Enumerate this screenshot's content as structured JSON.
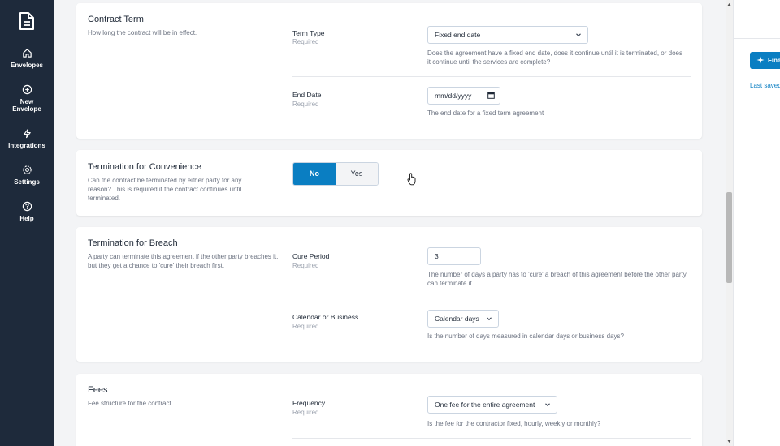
{
  "sidebar": {
    "items": [
      {
        "label": "Envelopes",
        "icon": "home-icon"
      },
      {
        "label": "New\nEnvelope",
        "icon": "plus-circle-icon"
      },
      {
        "label": "Integrations",
        "icon": "lightning-icon"
      },
      {
        "label": "Settings",
        "icon": "gear-icon"
      },
      {
        "label": "Help",
        "icon": "question-circle-icon"
      }
    ]
  },
  "contract_term": {
    "title": "Contract Term",
    "desc": "How long the contract will be in effect.",
    "term_type": {
      "label": "Term Type",
      "required": "Required",
      "value": "Fixed end date",
      "help": "Does the agreement have a fixed end date, does it continue until it is terminated, or does it continue until the services are complete?"
    },
    "end_date": {
      "label": "End Date",
      "required": "Required",
      "placeholder": "mm/dd/yyyy",
      "help": "The end date for a fixed term agreement"
    }
  },
  "termination_convenience": {
    "title": "Termination for Convenience",
    "desc": "Can the contract be terminated by either party for any reason? This is required if the contract continues until terminated.",
    "no_label": "No",
    "yes_label": "Yes",
    "selected": "No"
  },
  "termination_breach": {
    "title": "Termination for Breach",
    "desc": "A party can terminate this agreement if the other party breaches it, but they get a chance to 'cure' their breach first.",
    "cure_period": {
      "label": "Cure Period",
      "required": "Required",
      "value": "3",
      "help": "The number of days a party has to 'cure' a breach of this agreement before the other party can terminate it."
    },
    "calendar_business": {
      "label": "Calendar or Business",
      "required": "Required",
      "value": "Calendar days",
      "help": "Is the number of days measured in calendar days or business days?"
    }
  },
  "fees": {
    "title": "Fees",
    "desc": "Fee structure for the contract",
    "frequency": {
      "label": "Frequency",
      "required": "Required",
      "value": "One fee for the entire agreement",
      "help": "Is the fee for the contractor fixed, hourly, weekly or monthly?"
    }
  },
  "right_panel": {
    "finalize_label": "Finalize",
    "last_saved": "Last saved"
  },
  "colors": {
    "sidebar_bg": "#1e2a3b",
    "accent": "#0a7ec2"
  }
}
